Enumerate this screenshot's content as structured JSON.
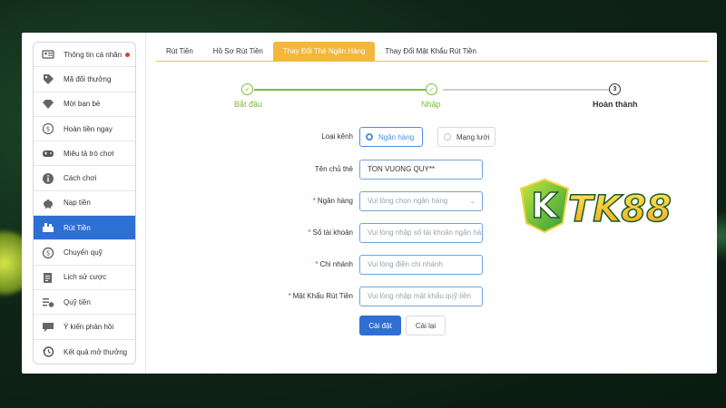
{
  "sidebar": {
    "items": [
      {
        "label": "Thông tin cá nhân",
        "icon": "id-card-icon",
        "dot": true
      },
      {
        "label": "Mã đổi thưởng",
        "icon": "tag-icon"
      },
      {
        "label": "Mời bạn bè",
        "icon": "diamond-icon"
      },
      {
        "label": "Hoàn tiền ngay",
        "icon": "refund-icon"
      },
      {
        "label": "Miêu tả trò chơi",
        "icon": "gamepad-icon"
      },
      {
        "label": "Cách chơi",
        "icon": "info-icon"
      },
      {
        "label": "Nạp tiền",
        "icon": "piggy-bank-icon"
      },
      {
        "label": "Rút Tiền",
        "icon": "withdraw-icon",
        "active": true
      },
      {
        "label": "Chuyển quỹ",
        "icon": "dollar-coin-icon"
      },
      {
        "label": "Lịch sử cược",
        "icon": "clipboard-icon"
      },
      {
        "label": "Quỹ tiền",
        "icon": "fund-list-icon"
      },
      {
        "label": "Ý kiến phản hồi",
        "icon": "chat-icon"
      },
      {
        "label": "Kết quả mở thưởng",
        "icon": "history-icon"
      }
    ]
  },
  "tabs": [
    {
      "label": "Rút Tiền"
    },
    {
      "label": "Hồ Sơ Rút Tiền"
    },
    {
      "label": "Thay Đổi Thẻ Ngân Hàng",
      "active": true
    },
    {
      "label": "Thay Đổi Mật Khẩu Rút Tiền"
    }
  ],
  "steps": [
    {
      "label": "Bắt đầu",
      "state": "done"
    },
    {
      "label": "Nhập",
      "state": "done"
    },
    {
      "label": "Hoàn thành",
      "state": "current",
      "number": "3"
    }
  ],
  "form": {
    "channel": {
      "label": "Loại kênh",
      "option_bank": "Ngân hàng",
      "option_network": "Mạng lưới",
      "selected": "Ngân hàng"
    },
    "holder": {
      "label": "Tên chủ thẻ",
      "value": "TON VUONG QUY**"
    },
    "bank": {
      "label": "Ngân hàng",
      "placeholder": "Vui lòng chọn ngân hàng"
    },
    "account": {
      "label": "Số tài khoản",
      "placeholder": "Vui lòng nhập số tài khoản ngân hà"
    },
    "branch": {
      "label": "Chi nhánh",
      "placeholder": "Vui lòng điền chi nhánh"
    },
    "password": {
      "label": "Mật Khẩu Rút Tiền",
      "placeholder": "Vui lòng nhập mật khẩu quỹ tiền"
    },
    "submit_label": "Cài đặt",
    "reset_label": "Cài lại"
  },
  "logo": {
    "text": "KTK88"
  },
  "colors": {
    "accent_blue": "#2e6fd4",
    "tab_active": "#f4b63c",
    "step_done": "#7cbb3b",
    "required": "#e53935"
  }
}
